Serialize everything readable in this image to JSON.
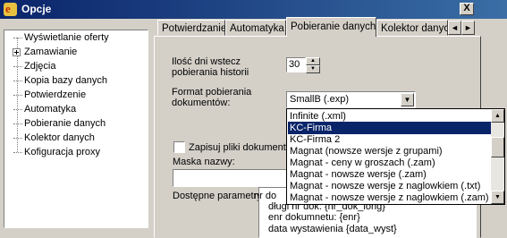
{
  "window": {
    "title": "Opcje",
    "close_glyph": "X"
  },
  "sidebar": {
    "items": [
      {
        "label": "Wyświetlanie oferty"
      },
      {
        "label": "Zamawianie",
        "expander": "+"
      },
      {
        "label": "Zdjęcia"
      },
      {
        "label": "Kopia bazy danych"
      },
      {
        "label": "Potwierdzenie"
      },
      {
        "label": "Automatyka"
      },
      {
        "label": "Pobieranie danych"
      },
      {
        "label": "Kolektor danych"
      },
      {
        "label": "Kofiguracja proxy"
      }
    ]
  },
  "tabs": [
    {
      "label": "Potwierdzanie"
    },
    {
      "label": "Automatyka"
    },
    {
      "label": "Pobieranie danych",
      "active": true
    },
    {
      "label": "Kolektor danyc"
    }
  ],
  "tab_scroll": {
    "left": "◄",
    "right": "►"
  },
  "form": {
    "days_label_1": "Ilość dni wstecz",
    "days_label_2": "pobierania historii",
    "days_value": "30",
    "format_label_1": "Format pobierania",
    "format_label_2": "dokumentów:",
    "format_selected": "SmallB (.exp)",
    "format_options": [
      "Infinite (.xml)",
      "KC-Firma",
      "KC-Firma 2",
      "Magnat (nowsze wersje z grupami)",
      "Magnat - ceny w groszach (.zam)",
      "Magnat - nowsze wersje (.zam)",
      "Magnat - nowsze wersje z naglowkiem (.txt)",
      "Magnat - nowsze wersje z naglowkiem (.zam)"
    ],
    "highlighted_option_index": 1,
    "save_files_label": "Zapisuj pliki dokumentó",
    "mask_label": "Maska nazwy:",
    "mask_value": "",
    "params_label": "Dostępne parametry:",
    "params": [
      "nr do",
      "długi nr dok: {nr_dok_long}",
      "enr dokumnetu: {enr}",
      "data wystawienia {data_wyst}"
    ]
  },
  "colors": {
    "titlebar": "#0a246a",
    "selection": "#0a246a",
    "face": "#d4d0c8"
  }
}
